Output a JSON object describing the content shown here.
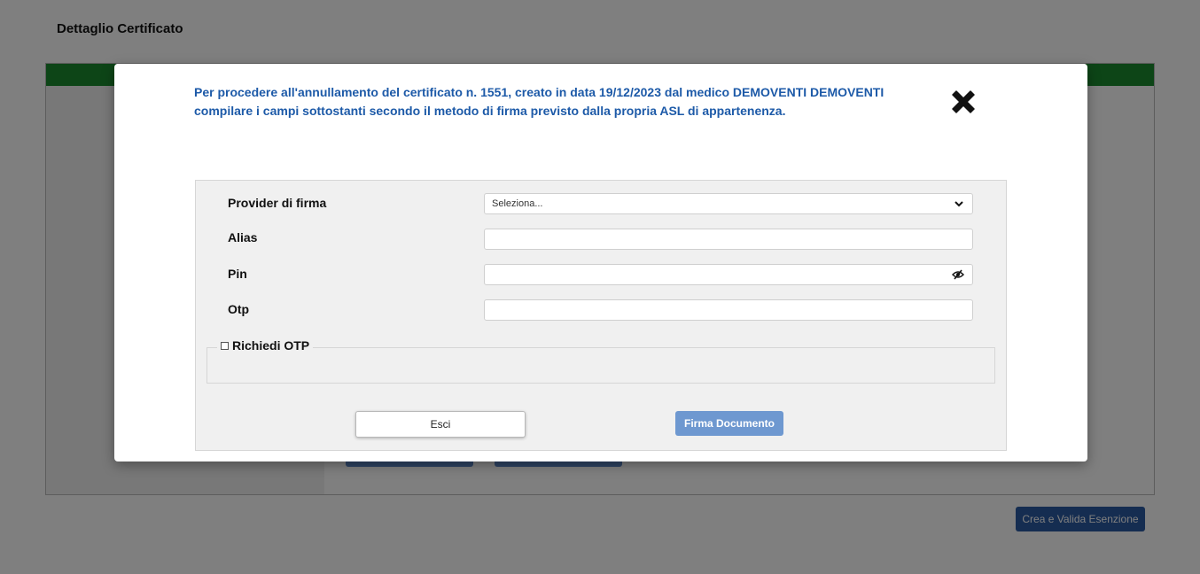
{
  "page": {
    "title": "Dettaglio Certificato",
    "crea_button": "Crea e Valida Esenzione"
  },
  "modal": {
    "message": "Per procedere all'annullamento del certificato n. 1551, creato in data 19/12/2023 dal medico DEMOVENTI DEMOVENTI compilare i campi sottostanti secondo il metodo di firma previsto dalla propria ASL di appartenenza.",
    "close_icon": "close-x-icon",
    "form": {
      "provider_label": "Provider di firma",
      "provider_value": "Seleziona...",
      "alias_label": "Alias",
      "alias_value": "",
      "pin_label": "Pin",
      "pin_value": "",
      "otp_label": "Otp",
      "otp_value": "",
      "richiedi_otp_label": "Richiedi OTP",
      "richiedi_otp_checked": false
    },
    "buttons": {
      "esci": "Esci",
      "firma": "Firma Documento"
    }
  },
  "colors": {
    "header_green": "#1a8a2e",
    "message_blue": "#1d5aa8",
    "primary_button": "#6e98d0",
    "crea_button": "#2a5aa2"
  }
}
